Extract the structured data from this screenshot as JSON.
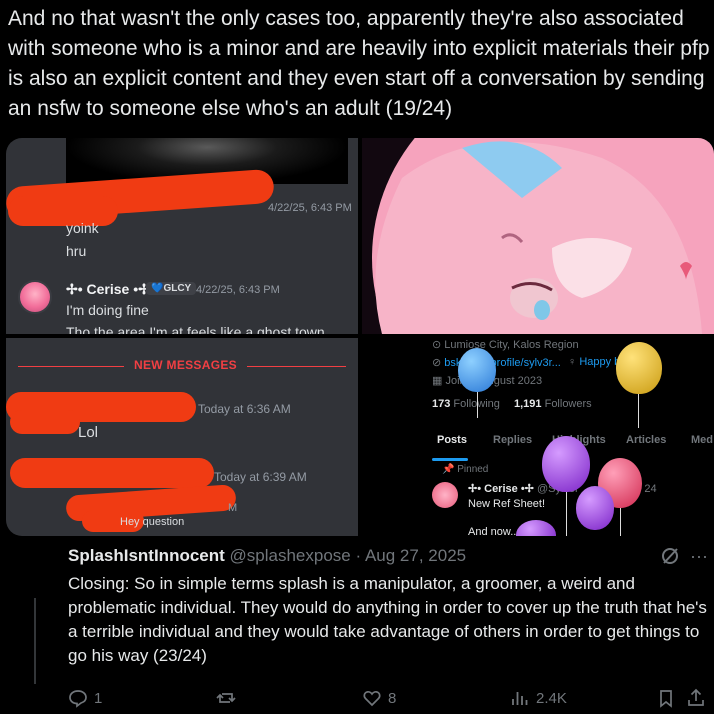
{
  "post_text": "And no that wasn't the only cases too, apparently they're also associated with someone who is a minor and are heavily into explicit materials their pfp is also an explicit content and they even start off a conversation by sending an nsfw to someone else who's an adult (19/24)",
  "panel1": {
    "ts1": "4/22/25, 6:43 PM",
    "msg1": "yoink",
    "msg2": "hru",
    "user": "✢• Cerise •✢",
    "badge": "💙GLCY",
    "ts2": "4/22/25, 6:43 PM",
    "msg3": "I'm doing fine",
    "msg4": "Tho the area I'm at feels like a ghost town"
  },
  "panel3": {
    "divider": "NEW MESSAGES",
    "ts1": "Today at 6:36 AM",
    "msg1": "Lol",
    "ts2": "Today at 6:39 AM",
    "ts3": "M",
    "msg2": "Hey question"
  },
  "panel4": {
    "location": "Lumiose City, Kalos Region",
    "link": "bsky.app/profile/sylv3r...",
    "birthday": "Happy birthday!",
    "joined": "Joined August 2023",
    "following_count": "173",
    "following_label": "Following",
    "followers_count": "1,191",
    "followers_label": "Followers",
    "tabs": [
      "Posts",
      "Replies",
      "Highlights",
      "Articles",
      "Med"
    ],
    "pinned": "Pinned",
    "pin_user": "✢• Cerise •✢",
    "pin_handle": "@Sylv3r",
    "pin_date": "Nov 24",
    "pin_text": "New Ref Sheet!",
    "pin_more": "And now..."
  },
  "tweet": {
    "name": "SplashIsntInnocent",
    "handle": "@splashexpose",
    "sep": "·",
    "date": "Aug 27, 2025",
    "body": "Closing: So in simple terms splash is a manipulator, a groomer, a weird and problematic individual. They would do anything in order to cover up the truth that he's a terrible individual and they would take advantage of others in order to get things to go his way (23/24)",
    "replies": "1",
    "likes": "8",
    "views": "2.4K"
  },
  "colors": {
    "redaction": "#f03b13",
    "discord_bg": "#313338",
    "new_messages": "#f23f43",
    "twitter_blue": "#1d9bf0"
  }
}
